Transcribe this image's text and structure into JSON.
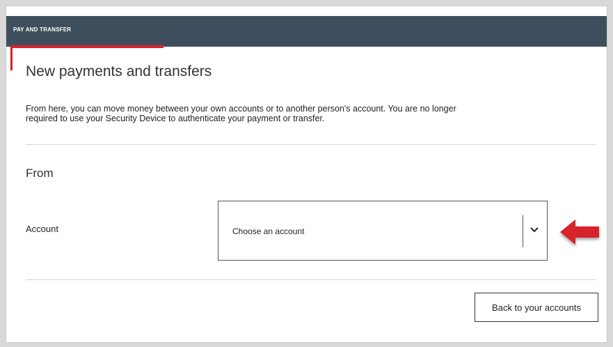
{
  "header": {
    "section_label": "PAY AND TRANSFER"
  },
  "main": {
    "title": "New payments and transfers",
    "intro_line1": "From here, you can move money between your own accounts or to another person's account. You are no longer",
    "intro_line2": "required to use your Security Device to authenticate your payment or transfer.",
    "from_heading": "From",
    "account_label": "Account",
    "account_select": {
      "selected_value": "Choose an account"
    },
    "back_button_label": "Back to your accounts"
  },
  "icons": {
    "dropdown": "chevron-down-icon",
    "annotation": "red-arrow-icon"
  },
  "colors": {
    "header_bg": "#3e4e5c",
    "accent_red": "#d7222a",
    "text": "#222222"
  }
}
